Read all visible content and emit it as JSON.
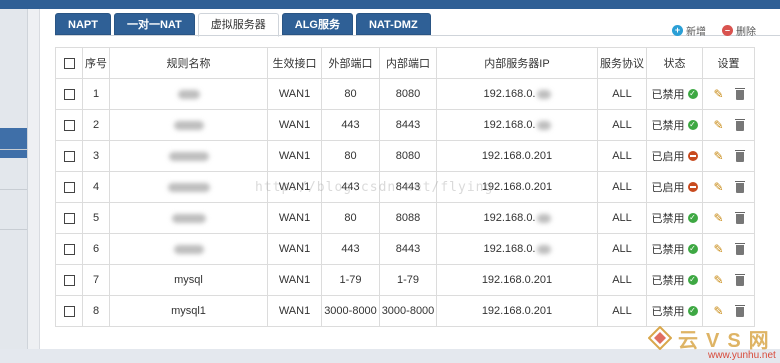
{
  "tabs": [
    "NAPT",
    "一对一NAT",
    "虚拟服务器",
    "ALG服务",
    "NAT-DMZ"
  ],
  "active_tab": 2,
  "top_actions": {
    "add": "新增",
    "delete": "删除"
  },
  "headers": [
    "序号",
    "规则名称",
    "生效接口",
    "外部端口",
    "内部端口",
    "内部服务器IP",
    "服务协议",
    "状态",
    "设置"
  ],
  "rows": [
    {
      "no": "1",
      "name": "",
      "iface": "WAN1",
      "ext": "80",
      "int": "8080",
      "ip": "192.168.0.",
      "proto": "ALL",
      "status": "已禁用",
      "enabled": false
    },
    {
      "no": "2",
      "name": "",
      "iface": "WAN1",
      "ext": "443",
      "int": "8443",
      "ip": "192.168.0.",
      "proto": "ALL",
      "status": "已禁用",
      "enabled": false
    },
    {
      "no": "3",
      "name": "",
      "iface": "WAN1",
      "ext": "80",
      "int": "8080",
      "ip": "192.168.0.201",
      "proto": "ALL",
      "status": "已启用",
      "enabled": true
    },
    {
      "no": "4",
      "name": "",
      "iface": "WAN1",
      "ext": "443",
      "int": "8443",
      "ip": "192.168.0.201",
      "proto": "ALL",
      "status": "已启用",
      "enabled": true
    },
    {
      "no": "5",
      "name": "",
      "iface": "WAN1",
      "ext": "80",
      "int": "8088",
      "ip": "192.168.0.",
      "proto": "ALL",
      "status": "已禁用",
      "enabled": false
    },
    {
      "no": "6",
      "name": "",
      "iface": "WAN1",
      "ext": "443",
      "int": "8443",
      "ip": "192.168.0.",
      "proto": "ALL",
      "status": "已禁用",
      "enabled": false
    },
    {
      "no": "7",
      "name": "mysql",
      "iface": "WAN1",
      "ext": "1-79",
      "int": "1-79",
      "ip": "192.168.0.201",
      "proto": "ALL",
      "status": "已禁用",
      "enabled": false
    },
    {
      "no": "8",
      "name": "mysql1",
      "iface": "WAN1",
      "ext": "3000-8000",
      "int": "3000-8000",
      "ip": "192.168.0.201",
      "proto": "ALL",
      "status": "已禁用",
      "enabled": false
    }
  ],
  "watermark": "http://blog.csdn.net/flying",
  "logo": {
    "text": "云VS网",
    "url": "www.yunhu.net"
  },
  "colors": {
    "tab_bg": "#2f6096",
    "ok": "#3ea843",
    "stop": "#c84a1e"
  }
}
